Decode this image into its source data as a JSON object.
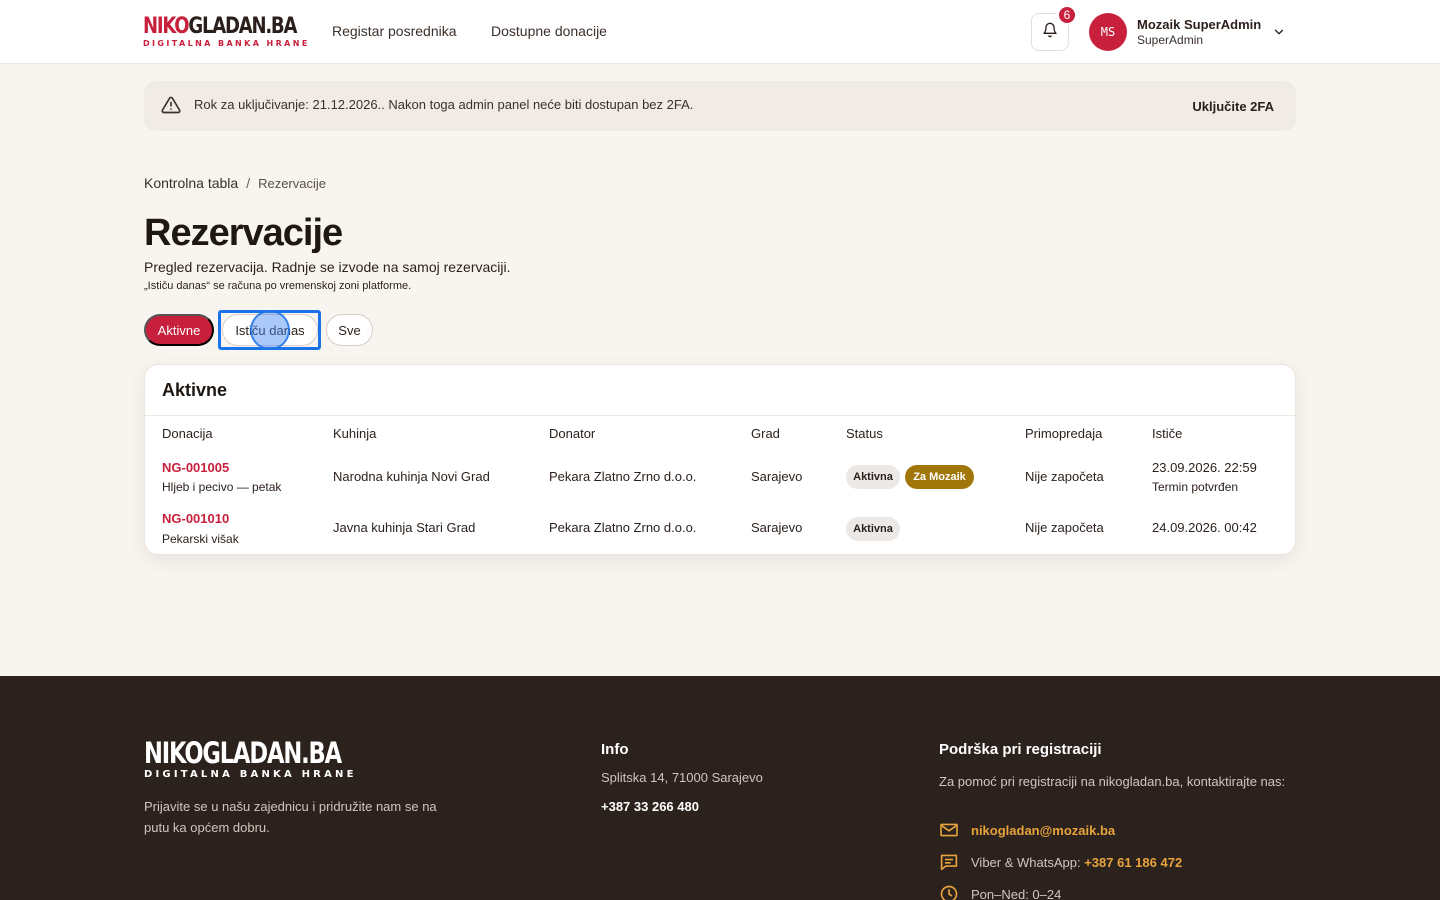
{
  "brand": {
    "logo_part1": "NIKO",
    "logo_part2": "GLADAN.BA",
    "tagline": "DIGITALNA BANKA HRANE",
    "accent_color": "#c8203c"
  },
  "nav": {
    "items": [
      "Registar posrednika",
      "Dostupne donacije"
    ]
  },
  "notifications": {
    "count": "6",
    "icon": "bell-icon"
  },
  "user": {
    "initials": "MS",
    "name": "Mozaik SuperAdmin",
    "role": "SuperAdmin"
  },
  "alert": {
    "text": "Rok za uključivanje: 21.12.2026.. Nakon toga admin panel neće biti dostupan bez 2FA.",
    "action": "Uključite 2FA"
  },
  "breadcrumb": {
    "parent": "Kontrolna tabla",
    "separator": "/",
    "current": "Rezervacije"
  },
  "page": {
    "title": "Rezervacije",
    "subtitle": "Pregled rezervacija. Radnje se izvode na samoj rezervaciji.",
    "note": "„Ističu danas“ se računa po vremenskoj zoni platforme."
  },
  "filters": [
    "Aktivne",
    "Ističu danas",
    "Sve"
  ],
  "table": {
    "title": "Aktivne",
    "columns": [
      "Donacija",
      "Kuhinja",
      "Donator",
      "Grad",
      "Status",
      "Primopredaja",
      "Ističe"
    ],
    "rows": [
      {
        "id": "NG-001005",
        "donation": "Hljeb i pecivo — petak",
        "kitchen": "Narodna kuhinja Novi Grad",
        "donor": "Pekara Zlatno Zrno d.o.o.",
        "city": "Sarajevo",
        "status": "Aktivna",
        "tag": "Za Mozaik",
        "handover": "Nije započeta",
        "expires": "23.09.2026. 22:59",
        "expires_note": "Termin potvrđen"
      },
      {
        "id": "NG-001010",
        "donation": "Pekarski višak",
        "kitchen": "Javna kuhinja Stari Grad",
        "donor": "Pekara Zlatno Zrno d.o.o.",
        "city": "Sarajevo",
        "status": "Aktivna",
        "handover": "Nije započeta",
        "expires": "24.09.2026. 00:42"
      }
    ]
  },
  "footer": {
    "logo": "NIKOGLADAN.BA",
    "logo_sub": "DIGITALNA BANKA HRANE",
    "tagline": "Prijavite se u našu zajednicu i pridružite nam se na putu ka općem dobru.",
    "info": {
      "heading": "Info",
      "address": "Splitska 14, 71000 Sarajevo",
      "phone": "+387 33 266 480"
    },
    "support": {
      "heading": "Podrška pri registraciji",
      "text": "Za pomoć pri registraciji na nikogladan.ba, kontaktirajte nas:",
      "email": "nikogladan@mozaik.ba",
      "viber_label": "Viber & WhatsApp:",
      "viber_number": "+387 61 186 472",
      "hours": "Pon–Ned: 0–24"
    }
  }
}
